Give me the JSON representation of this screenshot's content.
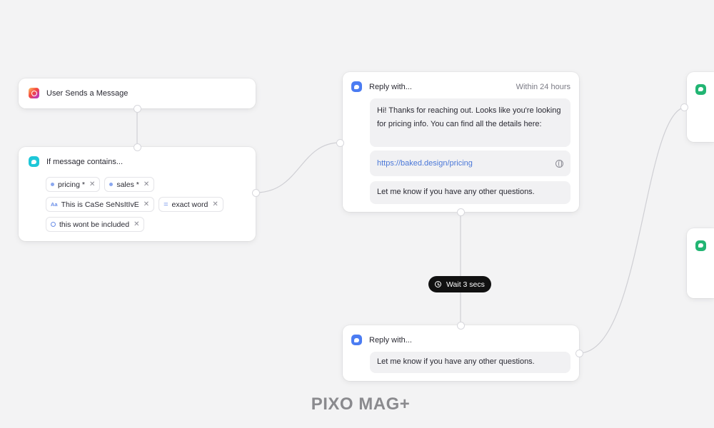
{
  "trigger": {
    "label": "User Sends a Message",
    "icon": "instagram-icon"
  },
  "condition": {
    "label": "If message contains...",
    "icon": "chat-bubble-icon",
    "chips_row1": [
      {
        "label": "pricing *",
        "icon": "dot-icon"
      },
      {
        "label": "sales *",
        "icon": "dot-icon"
      }
    ],
    "chips_row2": [
      {
        "label": "This is CaSe SeNsItIvE",
        "icon": "case-sensitive-icon"
      },
      {
        "label": "exact word",
        "icon": "equals-icon"
      }
    ],
    "chips_row3": [
      {
        "label": "this wont be included",
        "icon": "exclude-icon"
      }
    ],
    "remove_glyph": "✕"
  },
  "reply1": {
    "label": "Reply with...",
    "meta": "Within 24 hours",
    "icon": "chat-bubble-icon",
    "message": "Hi! Thanks for reaching out. Looks like you're looking for pricing info. You can find all the details here:",
    "link": "https://baked.design/pricing",
    "link_icon": "globe-icon",
    "followup": "Let me know if you have any other questions."
  },
  "wait": {
    "label": "Wait 3 secs",
    "icon": "clock-icon"
  },
  "reply2": {
    "label": "Reply with...",
    "icon": "chat-bubble-icon",
    "message": "Let me know if you have any other questions."
  },
  "watermark": "PIXO MAG+",
  "colors": {
    "background": "#f3f3f4",
    "link": "#4b78d8",
    "accent_blue": "#4b7cf2",
    "accent_cyan": "#1ec7d8",
    "accent_green": "#22b573",
    "wait_pill": "#111111"
  }
}
